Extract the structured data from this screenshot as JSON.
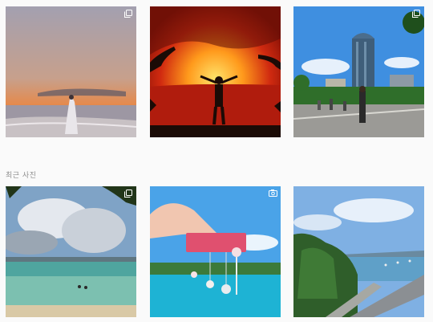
{
  "sections": {
    "recent_label": "최근 사진"
  },
  "top_row": [
    {
      "id": "beach-sunset-post",
      "badge": "multi-photo-icon"
    },
    {
      "id": "red-sky-silhouette-post",
      "badge": ""
    },
    {
      "id": "tower-plaza-post",
      "badge": "multi-photo-icon"
    }
  ],
  "recent_row": [
    {
      "id": "island-sea-post",
      "badge": "multi-photo-icon"
    },
    {
      "id": "earring-card-post",
      "badge": "video-camera-icon"
    },
    {
      "id": "coastal-road-post",
      "badge": ""
    }
  ],
  "colors": {
    "page_bg": "#fafafa",
    "label_gray": "#8e8e8e",
    "icon_white": "#ffffff"
  }
}
